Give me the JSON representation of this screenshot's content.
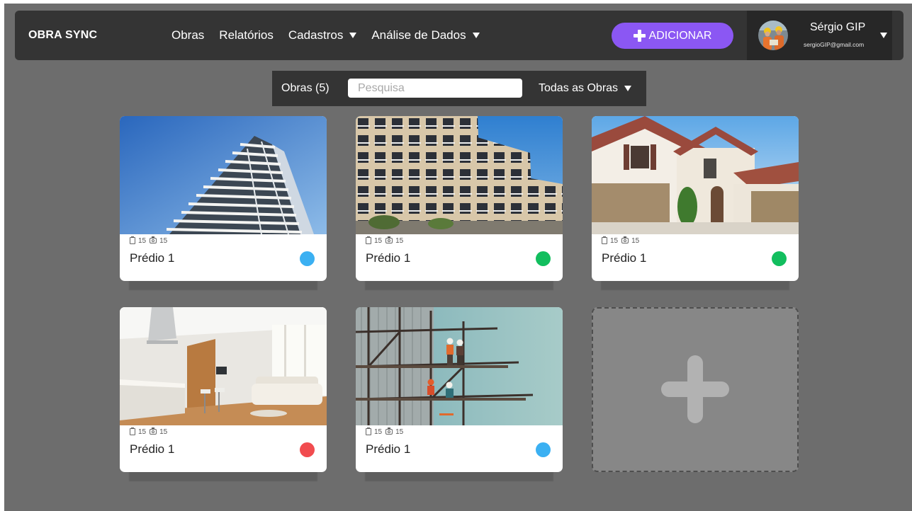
{
  "app": {
    "brand": "OBRA SYNC"
  },
  "nav": {
    "items": [
      {
        "label": "Obras"
      },
      {
        "label": "Relatórios"
      },
      {
        "label": "Cadastros",
        "icon": "chevron-down-icon"
      },
      {
        "label": "Análise de Dados",
        "icon": "chevron-down-icon"
      }
    ],
    "add_button": {
      "label": "ADICIONAR",
      "icon": "plus-icon"
    }
  },
  "user": {
    "name": "Sérgio GIP",
    "email": "sergioGIP@gmail.com",
    "menu_icon": "chevron-down-icon"
  },
  "filter": {
    "count_label": "Obras (5)",
    "search_placeholder": "Pesquisa",
    "search_value": "",
    "scope": "Todas as Obras"
  },
  "card_stat_icons": [
    "clipboard-icon",
    "camera-icon"
  ],
  "cards": [
    {
      "title": "Prédio 1",
      "docs_count": "15",
      "photos_count": "15",
      "status_color": "#3bb0f2"
    },
    {
      "title": "Prédio 1",
      "docs_count": "15",
      "photos_count": "15",
      "status_color": "#12be5e"
    },
    {
      "title": "Prédio 1",
      "docs_count": "15",
      "photos_count": "15",
      "status_color": "#12be5e"
    },
    {
      "title": "Prédio 1",
      "docs_count": "15",
      "photos_count": "15",
      "status_color": "#f14c4f"
    },
    {
      "title": "Prédio 1",
      "docs_count": "15",
      "photos_count": "15",
      "status_color": "#3bb0f2"
    }
  ],
  "add_card": {
    "icon": "plus-icon"
  },
  "colors": {
    "accent": "#8b57f3",
    "background": "#6d6d6d",
    "panel": "#343434",
    "user_panel": "#272727"
  }
}
